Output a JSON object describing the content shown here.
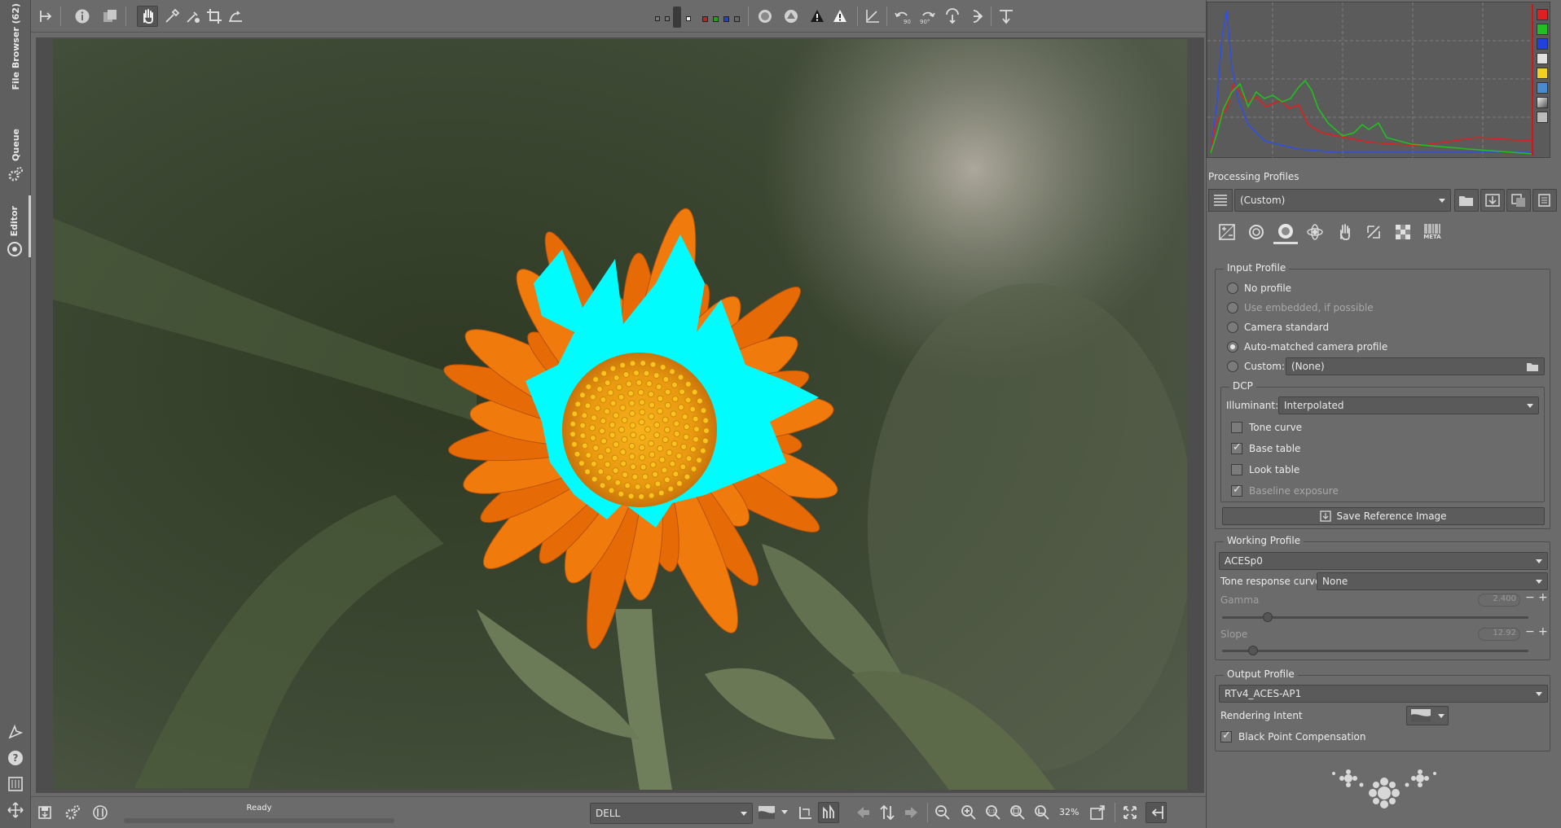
{
  "left_tabs": [
    {
      "label": "File Browser (62)",
      "icon": "folder-icon"
    },
    {
      "label": "Queue",
      "icon": "gears-icon"
    },
    {
      "label": "Editor",
      "icon": "aperture-icon"
    }
  ],
  "left_bottom_icons": [
    "export-icon",
    "help-icon",
    "preferences-icon",
    "fullscreen-icon"
  ],
  "toolbar": {
    "icons": [
      "hide-history-icon",
      "info-icon",
      "before-after-icon",
      "hand-icon",
      "color-picker-icon",
      "white-balance-icon",
      "crop-icon",
      "straighten-icon"
    ],
    "right_icons": [
      "preview-mode-icon",
      "focus-mask-icon",
      "shadow-clip-icon",
      "highlight-clip-icon",
      "warning-icon",
      "graph-icon",
      "rotate-ccw-icon",
      "rotate-cw-icon",
      "flip-h-icon",
      "flip-v-icon",
      "toggle-panel-icon"
    ]
  },
  "status": {
    "text": "Ready"
  },
  "bottombar": {
    "monitor_profile": "DELL",
    "zoom": "32%"
  },
  "histogram": {
    "channel_colors": [
      "#e02020",
      "#20c020",
      "#2040e0",
      "#e0e0e0",
      "#f0d020"
    ]
  },
  "processing_profiles": {
    "title": "Processing Profiles",
    "value": "(Custom)"
  },
  "tool_tabs": [
    "exposure-icon",
    "detail-icon",
    "color-icon",
    "advanced-icon",
    "locallab-icon",
    "transform-icon",
    "raw-icon",
    "meta-icon"
  ],
  "tool_tab_meta_label": "META",
  "input_profile": {
    "title": "Input Profile",
    "options": [
      {
        "label": "No profile",
        "selected": false,
        "disabled": false
      },
      {
        "label": "Use embedded, if possible",
        "selected": false,
        "disabled": true
      },
      {
        "label": "Camera standard",
        "selected": false,
        "disabled": false
      },
      {
        "label": "Auto-matched camera profile",
        "selected": true,
        "disabled": false
      },
      {
        "label": "Custom:",
        "selected": false,
        "disabled": false
      }
    ],
    "custom_value": "(None)",
    "dcp": {
      "title": "DCP",
      "illuminant_label": "Illuminant:",
      "illuminant_value": "Interpolated",
      "tone_curve": "Tone curve",
      "base_table": "Base table",
      "look_table": "Look table",
      "baseline_exposure": "Baseline exposure",
      "save_reference": "Save Reference Image"
    }
  },
  "working_profile": {
    "title": "Working Profile",
    "value": "ACESp0",
    "trc_label": "Tone response curve:",
    "trc_value": "None",
    "gamma_label": "Gamma",
    "gamma_value": "2.400",
    "slope_label": "Slope",
    "slope_value": "12.92"
  },
  "output_profile": {
    "title": "Output Profile",
    "value": "RTv4_ACES-AP1",
    "intent_label": "Rendering Intent",
    "bpc_label": "Black Point Compensation"
  }
}
